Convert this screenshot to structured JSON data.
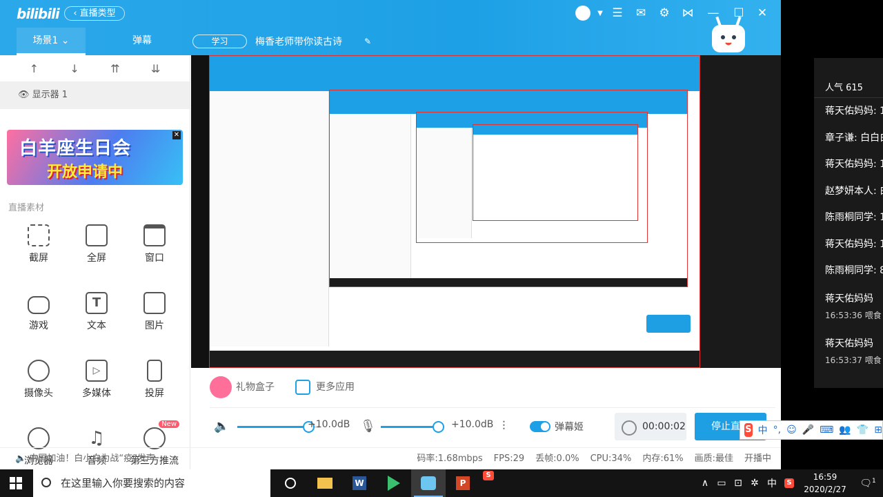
{
  "app": {
    "logo": "bilibili",
    "live_type_button": "直播类型",
    "scene_tab": "场景1",
    "danmu_tab": "弹幕",
    "category": "学习",
    "room_title": "梅香老师带你读古诗"
  },
  "sources": {
    "display_item": "显示器 1"
  },
  "banner": {
    "line1": "白羊座生日会",
    "line2": "开放申请中"
  },
  "materials": {
    "title": "直播素材",
    "tools": [
      {
        "label": "截屏",
        "icon": "crop-icon"
      },
      {
        "label": "全屏",
        "icon": "monitor-icon"
      },
      {
        "label": "窗口",
        "icon": "window-icon"
      },
      {
        "label": "游戏",
        "icon": "gamepad-icon"
      },
      {
        "label": "文本",
        "icon": "text-icon"
      },
      {
        "label": "图片",
        "icon": "image-icon"
      },
      {
        "label": "摄像头",
        "icon": "webcam-icon"
      },
      {
        "label": "多媒体",
        "icon": "media-icon"
      },
      {
        "label": "投屏",
        "icon": "phone-icon"
      },
      {
        "label": "浏览器",
        "icon": "planet-icon"
      },
      {
        "label": "音频",
        "icon": "music-icon"
      },
      {
        "label": "第三方推流",
        "icon": "stream-icon",
        "badge": "New"
      }
    ]
  },
  "bottom": {
    "gift_box": "礼物盒子",
    "more_apps": "更多应用",
    "speaker_db": "+10.0dB",
    "mic_db": "+10.0dB",
    "speaker_level": 0.86,
    "mic_level": 0.9,
    "danmuji": "弹幕姬",
    "timer": "00:00:02",
    "stop_button": "停止直播"
  },
  "status": {
    "slogan": "中国加油！白小白为战“疫”发声",
    "bitrate": "码率:1.68mbps",
    "fps": "FPS:29",
    "dropped": "丢帧:0.0%",
    "cpu": "CPU:34%",
    "memory": "内存:61%",
    "quality": "画质:最佳",
    "state": "开播中"
  },
  "chat": {
    "popularity": "人气 615",
    "messages": [
      "蒋天佑妈妈: 1",
      "章子谦: 白白白",
      "蒋天佑妈妈: 1",
      "赵梦妍本人: 白",
      "陈雨桐同学: 1",
      "蒋天佑妈妈: 1",
      "陈雨桐同学: 8"
    ],
    "gifts": [
      {
        "user": "蒋天佑妈妈",
        "time": "16:53:36 喂食"
      },
      {
        "user": "蒋天佑妈妈",
        "time": "16:53:37 喂食"
      }
    ]
  },
  "ime": {
    "mode": "中"
  },
  "taskbar": {
    "search_placeholder": "在这里输入你要搜索的内容",
    "ime": "中",
    "time": "16:59",
    "date": "2020/2/27",
    "notifications": "1"
  },
  "colors": {
    "accent": "#1ea0e6",
    "gift": "#ff6f9a",
    "new_badge": "#ff5a6e"
  }
}
